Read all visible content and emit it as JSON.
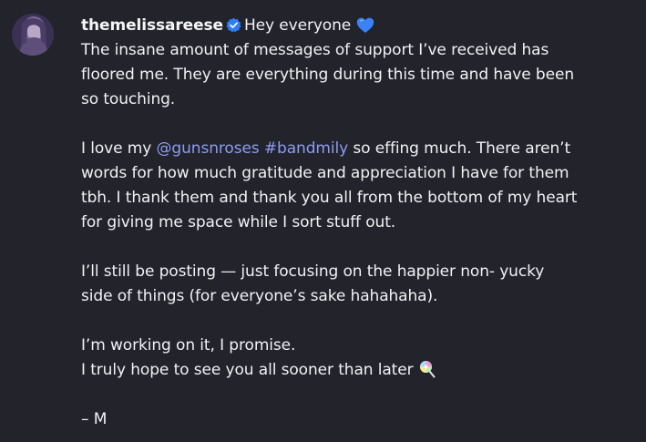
{
  "post": {
    "username": "themelissareese",
    "lines": {
      "l1_after_username": "Hey everyone",
      "l2": "The insane amount of messages of support I’ve received has",
      "l3": "floored me. They are everything during this time and have been",
      "l4": "so touching.",
      "l6_before": "I love my ",
      "l6_mention": "@gunsnroses",
      "l6_space": " ",
      "l6_hashtag": "#bandmily",
      "l6_after": " so effing much. There aren’t",
      "l7": "words for how much gratitude and appreciation I have for them",
      "l8": "tbh. I thank them and thank you all from the bottom of my heart",
      "l9": "for giving me space while I sort stuff out.",
      "l11": "I’ll still be posting — just focusing on the happier non- yucky",
      "l12": "side of things (for everyone’s sake hahahaha).",
      "l14": "I’m working on it, I promise.",
      "l15": "I truly hope to see you all sooner than later",
      "l17": "– M"
    },
    "icons": {
      "verified": "verified-badge-icon",
      "heart": "blue-heart-emoji",
      "lollipop": "lollipop-emoji"
    },
    "colors": {
      "background": "#22232b",
      "text": "#f2f2f4",
      "link": "#8c9cf2",
      "verified": "#2f7df6",
      "heart": "#3b82f6"
    }
  }
}
